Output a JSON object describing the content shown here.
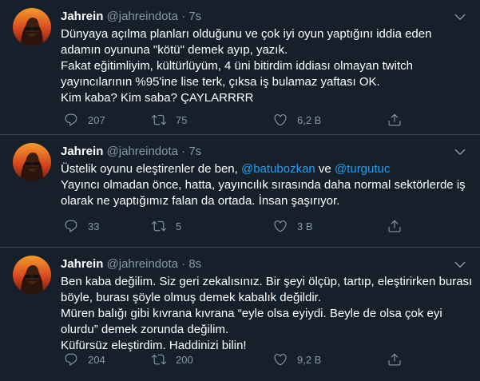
{
  "tweets": [
    {
      "name": "Jahrein",
      "handle": "@jahreindota",
      "separator": "·",
      "time": "7s",
      "lines": [
        "Dünyaya açılma planları olduğunu ve çok iyi oyun yaptığını iddia eden",
        "adamın oyununa \"kötü\" demek ayıp, yazık.",
        "Fakat eğitimliyim, kültürlüyüm, 4 üni bitirdim iddiası olmayan twitch",
        "yayıncılarının %95'ine lise terk, çıksa iş bulamaz yaftası OK.",
        "Kim kaba? Kim saba? ÇAYLARRRR"
      ],
      "replies": "207",
      "retweets": "75",
      "likes": "6,2 B"
    },
    {
      "name": "Jahrein",
      "handle": "@jahreindota",
      "separator": "·",
      "time": "7s",
      "line1_prefix": "Üstelik oyunu eleştirenler de ben, ",
      "mention1": "@batubozkan",
      "line1_mid": " ve ",
      "mention2": "@turgutuc",
      "lines": [
        "Yayıncı olmadan önce, hatta, yayıncılık sırasında daha normal sektörlerde iş",
        "olarak ne yaptığımız falan da ortada. İnsan şaşırıyor."
      ],
      "replies": "33",
      "retweets": "5",
      "likes": "3 B"
    },
    {
      "name": "Jahrein",
      "handle": "@jahreindota",
      "separator": "·",
      "time": "8s",
      "lines": [
        "Ben kaba değilim. Siz geri zekalısınız. Bir şeyi ölçüp, tartıp, eleştirirken burası",
        "böyle, burası şöyle olmuş demek kabalık değildir.",
        "Müren balığı gibi kıvrana kıvrana “eyle olsa eyiydi. Beyle de olsa çok eyi",
        "olurdu” demek zorunda değilim.",
        "Küfürsüz eleştirdim. Haddinizi bilin!"
      ],
      "replies": "204",
      "retweets": "200",
      "likes": "9,2 B"
    }
  ],
  "icons": {
    "reply": "reply-icon",
    "retweet": "retweet-icon",
    "like": "heart-icon",
    "share": "share-icon",
    "more": "chevron-down-icon"
  },
  "colors": {
    "background": "#15202b",
    "text": "#ffffff",
    "secondary": "#8899a6",
    "link": "#1da1f2",
    "divider": "#38444d"
  }
}
